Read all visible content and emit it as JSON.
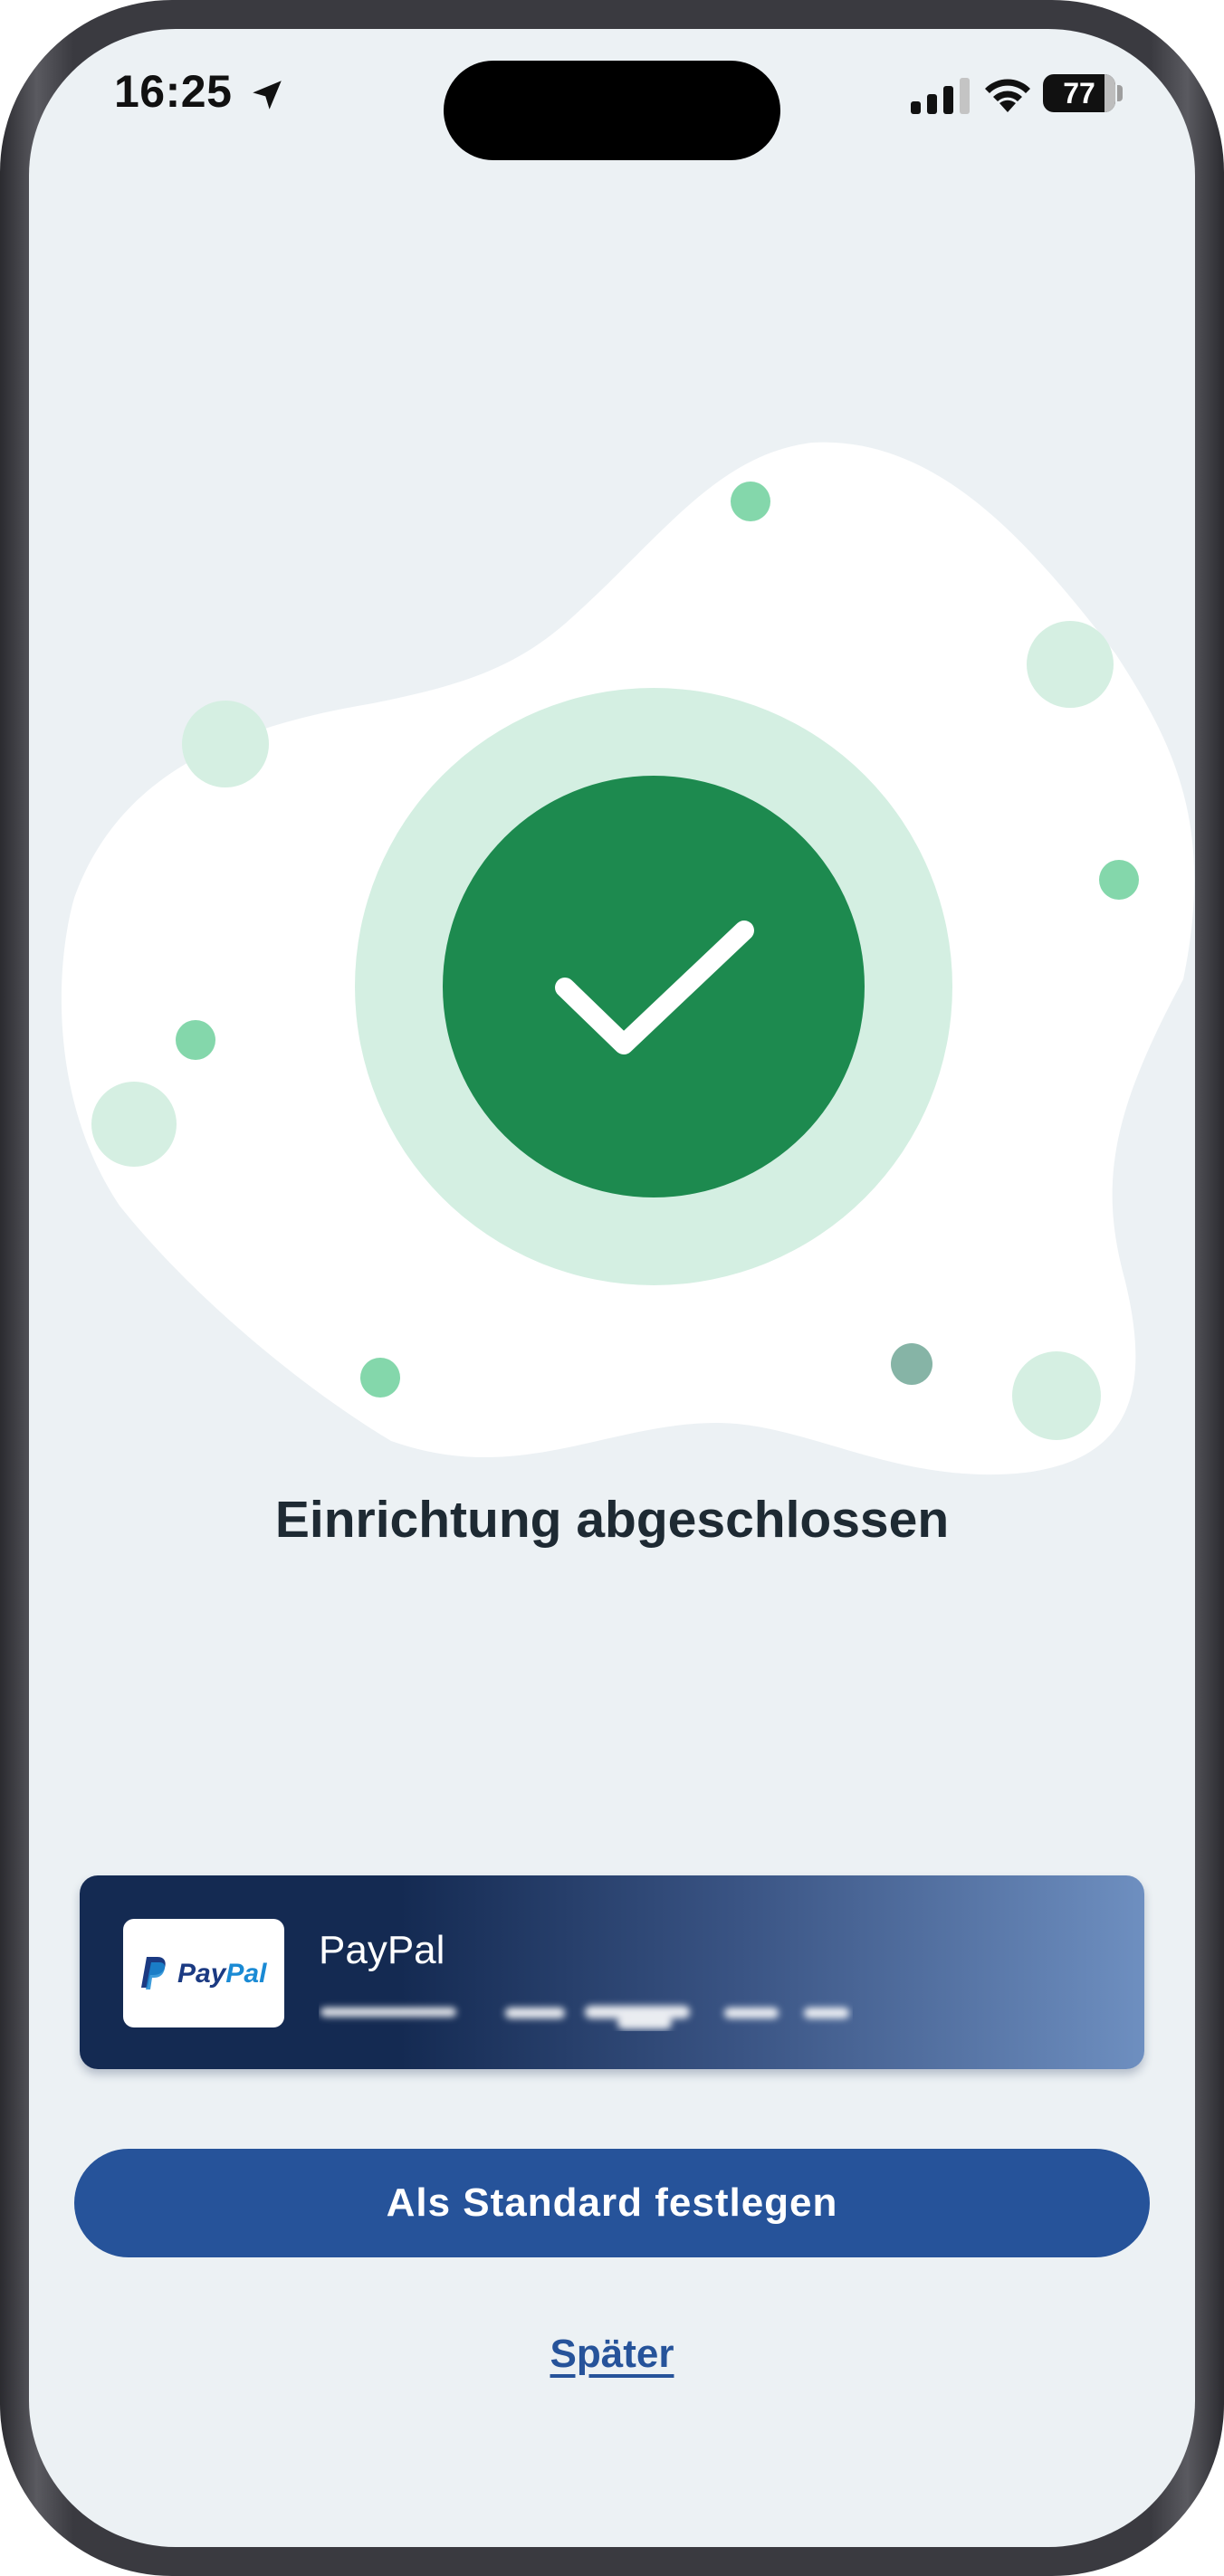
{
  "status_bar": {
    "time": "16:25",
    "battery": "77"
  },
  "main": {
    "title": "Einrichtung abgeschlossen"
  },
  "payment_method": {
    "name": "PayPal",
    "logo_text_pay": "Pay",
    "logo_text_pal": "Pal"
  },
  "actions": {
    "set_default_label": "Als Standard festlegen",
    "later_label": "Später"
  },
  "colors": {
    "background": "#ecf1f4",
    "success_green": "#1d8a4f",
    "success_halo": "#d4efe2",
    "primary_blue": "#26539a"
  }
}
